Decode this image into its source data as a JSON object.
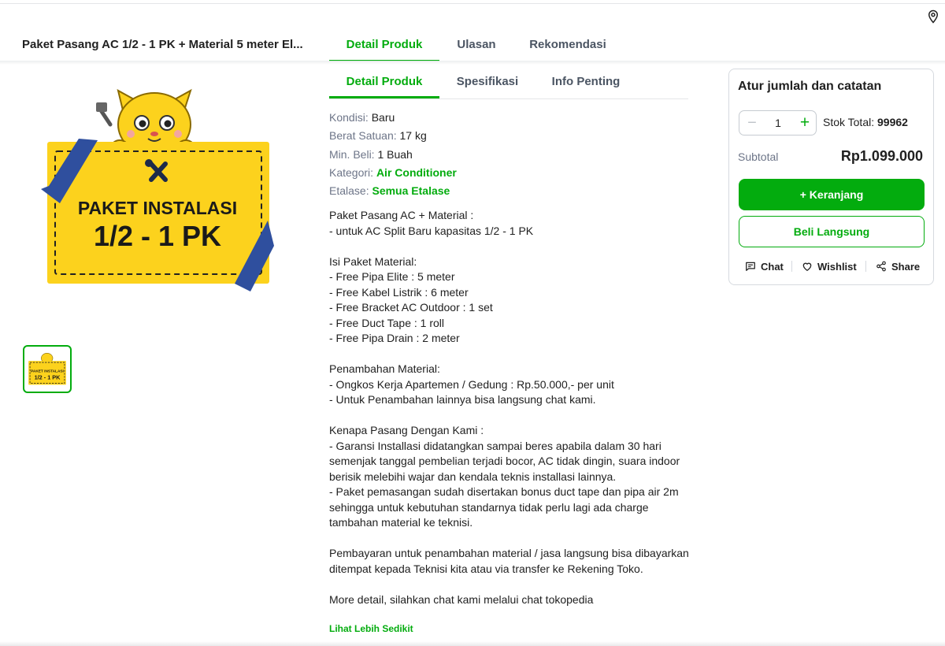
{
  "header": {
    "location_icon": "map-pin-icon",
    "product_title": "Paket Pasang AC 1/2 - 1 PK + Material 5 meter El...",
    "tabs": [
      {
        "label": "Detail Produk",
        "active": true
      },
      {
        "label": "Ulasan",
        "active": false
      },
      {
        "label": "Rekomendasi",
        "active": false
      }
    ]
  },
  "gallery": {
    "banner_title": "PAKET INSTALASI",
    "banner_subtitle": "1/2 - 1 PK",
    "thumbnail_count": 1
  },
  "detail": {
    "tabs": [
      {
        "label": "Detail Produk",
        "active": true
      },
      {
        "label": "Spesifikasi",
        "active": false
      },
      {
        "label": "Info Penting",
        "active": false
      }
    ],
    "specs": [
      {
        "label": "Kondisi: ",
        "value": "Baru",
        "link": false
      },
      {
        "label": "Berat Satuan: ",
        "value": "17 kg",
        "link": false
      },
      {
        "label": "Min. Beli: ",
        "value": "1 Buah",
        "link": false
      },
      {
        "label": "Kategori: ",
        "value": "Air Conditioner",
        "link": true
      },
      {
        "label": "Etalase: ",
        "value": "Semua Etalase",
        "link": true
      }
    ],
    "description": "Paket Pasang AC + Material :\n- untuk AC Split Baru kapasitas 1/2 - 1 PK\n\nIsi Paket Material:\n- Free Pipa Elite : 5 meter\n- Free Kabel Listrik : 6 meter\n- Free Bracket AC Outdoor : 1 set\n- Free Duct Tape : 1 roll\n- Free Pipa Drain : 2 meter\n\nPenambahan Material:\n- Ongkos Kerja Apartemen / Gedung : Rp.50.000,- per unit\n- Untuk Penambahan lainnya bisa langsung chat kami.\n\nKenapa Pasang Dengan Kami :\n- Garansi Installasi didatangkan sampai beres apabila dalam 30 hari semenjak tanggal pembelian terjadi bocor, AC tidak dingin, suara indoor berisik melebihi wajar dan kendala teknis installasi lainnya.\n- Paket pemasangan sudah disertakan bonus duct tape dan pipa air 2m sehingga untuk kebutuhan standarnya tidak perlu lagi ada charge tambahan material ke teknisi.\n\nPembayaran untuk penambahan material / jasa langsung bisa dibayarkan ditempat kepada Teknisi kita atau via transfer ke Rekening Toko.\n\nMore detail, silahkan chat kami melalui chat tokopedia",
    "show_less_label": "Lihat Lebih Sedikit"
  },
  "purchase_panel": {
    "title": "Atur jumlah dan catatan",
    "quantity": "1",
    "stock_label": "Stok Total: ",
    "stock_value": "99962",
    "subtotal_label": "Subtotal",
    "subtotal_value": "Rp1.099.000",
    "cart_button": "+ Keranjang",
    "buy_button": "Beli Langsung",
    "actions": [
      {
        "label": "Chat",
        "icon": "chat-icon"
      },
      {
        "label": "Wishlist",
        "icon": "heart-icon"
      },
      {
        "label": "Share",
        "icon": "share-icon"
      }
    ]
  },
  "colors": {
    "accent": "#03ac0e",
    "banner_yellow": "#fcd21d",
    "ribbon_blue": "#2f4f9e",
    "text_primary": "#212121",
    "text_secondary": "#6d7588"
  }
}
